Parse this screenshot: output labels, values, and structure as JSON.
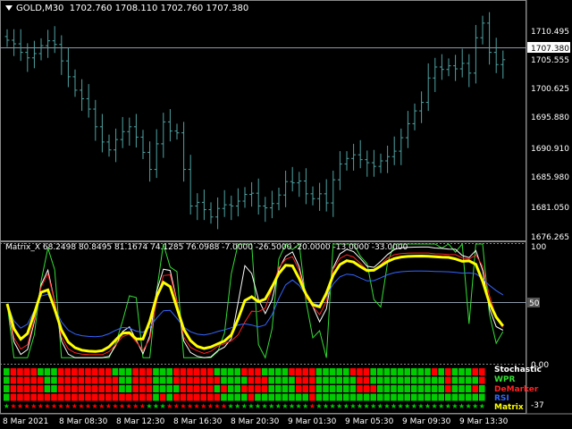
{
  "header": {
    "symbol_timeframe": "GOLD,M30",
    "ohlc": "1702.760 1708.110 1702.760 1707.380"
  },
  "price_axis": {
    "labels": [
      "1710.495",
      "1705.555",
      "1700.625",
      "1695.880",
      "1690.910",
      "1685.980",
      "1681.050",
      "1676.265"
    ],
    "current_price": "1707.380"
  },
  "indicator": {
    "header": "Matrix_X 68.2498 80.8495 81.1674 74.1285 76.0988 -7.0000 -26.5000 -20.0000 -13.0000 -33.0000",
    "axis_labels": {
      "top": "100",
      "mid": "50",
      "zero": "0.00",
      "bottom": "-37"
    },
    "legend": [
      {
        "label": "Stochastic",
        "color": "#ffffff"
      },
      {
        "label": "WPR",
        "color": "#33dd33"
      },
      {
        "label": "DeMarker",
        "color": "#ff2222"
      },
      {
        "label": "RSI",
        "color": "#3366ff"
      },
      {
        "label": "Matrix",
        "color": "#ffff00"
      }
    ]
  },
  "time_axis": {
    "labels": [
      "8 Mar 2021",
      "8 Mar 08:30",
      "8 Mar 12:30",
      "8 Mar 16:30",
      "8 Mar 20:30",
      "9 Mar 01:30",
      "9 Mar 05:30",
      "9 Mar 09:30",
      "9 Mar 13:30"
    ]
  },
  "colors": {
    "background": "#000000",
    "candle": "#4fa3a3",
    "grid": "#666666",
    "bull_cell": "#00cc00",
    "bear_cell": "#ff0000",
    "matrix_line": "#ffff00",
    "stochastic": "#ffffff",
    "wpr": "#33dd33",
    "demarker": "#ff2222",
    "rsi": "#3366ff"
  },
  "chart_data": {
    "type": "candlestick",
    "series_name": "GOLD,M30",
    "ylim": [
      1675.5,
      1714.5
    ],
    "close": [
      1708.2,
      1707.6,
      1706.2,
      1705.3,
      1706.0,
      1707.3,
      1708.1,
      1707.5,
      1704.8,
      1702.2,
      1700.0,
      1698.6,
      1696.9,
      1694.0,
      1691.5,
      1690.2,
      1691.9,
      1693.2,
      1694.0,
      1692.3,
      1689.8,
      1687.0,
      1691.2,
      1694.8,
      1693.3,
      1693.0,
      1687.0,
      1681.0,
      1681.6,
      1680.4,
      1679.2,
      1680.6,
      1681.2,
      1681.0,
      1681.8,
      1682.9,
      1683.1,
      1681.0,
      1680.7,
      1681.4,
      1682.8,
      1685.0,
      1684.8,
      1685.1,
      1683.0,
      1682.2,
      1683.0,
      1681.5,
      1685.3,
      1687.9,
      1688.8,
      1689.4,
      1688.6,
      1688.1,
      1687.5,
      1688.4,
      1689.1,
      1690.0,
      1692.2,
      1694.5,
      1696.6,
      1698.0,
      1702.0,
      1703.8,
      1703.4,
      1704.0,
      1703.5,
      1704.4,
      1702.8,
      1708.6,
      1711.0,
      1706.2,
      1704.2,
      1705.0
    ]
  }
}
